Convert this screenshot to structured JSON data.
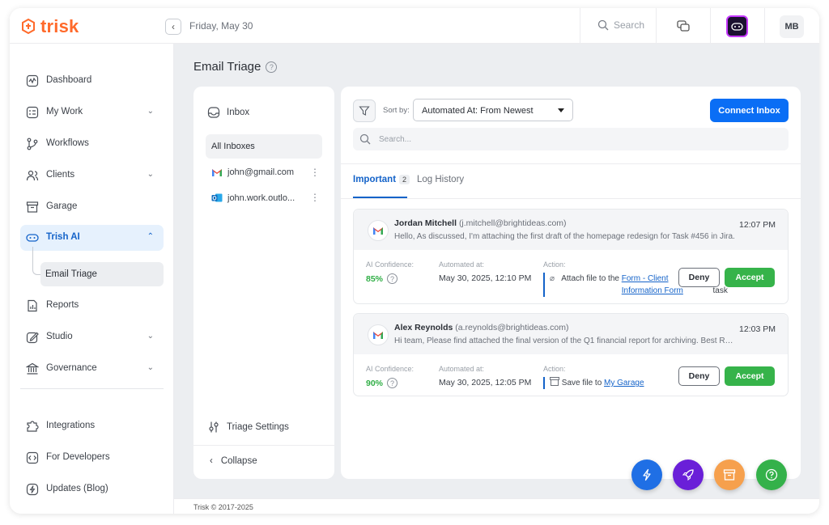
{
  "app": {
    "logo_text": "trisk",
    "brand_color": "#ff6a2b",
    "accent_color": "#0a6ef5"
  },
  "topbar": {
    "date": "Friday, May 30",
    "search_placeholder": "Search",
    "avatar_initials": "MB"
  },
  "sidebar": {
    "items": [
      {
        "label": "Dashboard",
        "icon": "dashboard-icon"
      },
      {
        "label": "My Work",
        "icon": "my-work-icon",
        "chevron": "down"
      },
      {
        "label": "Workflows",
        "icon": "workflow-icon"
      },
      {
        "label": "Clients",
        "icon": "clients-icon",
        "chevron": "down"
      },
      {
        "label": "Garage",
        "icon": "archive-icon"
      },
      {
        "label": "Trish AI",
        "icon": "bot-icon",
        "chevron": "up",
        "active": true
      },
      {
        "label": "Reports",
        "icon": "reports-icon"
      },
      {
        "label": "Studio",
        "icon": "edit-icon",
        "chevron": "down"
      },
      {
        "label": "Governance",
        "icon": "bank-icon",
        "chevron": "down"
      }
    ],
    "sub_item": "Email Triage",
    "bottom_items": [
      {
        "label": "Integrations",
        "icon": "puzzle-icon"
      },
      {
        "label": "For Developers",
        "icon": "code-icon"
      },
      {
        "label": "Updates (Blog)",
        "icon": "updates-icon"
      }
    ]
  },
  "page": {
    "title": "Email Triage"
  },
  "inbox_panel": {
    "heading": "Inbox",
    "all_inboxes": "All Inboxes",
    "accounts": [
      {
        "email": "john@gmail.com",
        "provider": "gmail-icon"
      },
      {
        "email": "john.work.outlo...",
        "provider": "outlook-icon"
      }
    ],
    "settings_label": "Triage Settings",
    "collapse_label": "Collapse"
  },
  "mail_panel": {
    "sort_label": "Sort by:",
    "sort_value": "Automated At: From Newest",
    "connect_label": "Connect Inbox",
    "search_placeholder": "Search...",
    "tabs": [
      {
        "label": "Important",
        "count": "2",
        "active": true
      },
      {
        "label": "Log History"
      }
    ],
    "labels": {
      "confidence": "AI Confidence:",
      "automated": "Automated at:",
      "action": "Action:",
      "deny": "Deny",
      "accept": "Accept"
    },
    "emails": [
      {
        "sender": "Jordan Mitchell",
        "address": "(j.mitchell@brightideas.com)",
        "preview": "Hello, As discussed, I'm attaching the first draft of the homepage redesign for Task #456 in Jira.",
        "time": "12:07 PM",
        "confidence": "85%",
        "automated_at": "May 30, 2025, 12:10 PM",
        "action_icon": "paperclip-icon",
        "action_prefix": "Attach file to the",
        "action_link": "Form - Client Information Form",
        "action_suffix": "task"
      },
      {
        "sender": "Alex Reynolds",
        "address": "(a.reynolds@brightideas.com)",
        "preview": "Hi team, Please find attached the final version of the Q1 financial report for archiving. Best Regards.",
        "time": "12:03 PM",
        "confidence": "90%",
        "automated_at": "May 30, 2025, 12:05 PM",
        "action_icon": "archive-icon",
        "action_prefix": "Save file to",
        "action_link": "My Garage",
        "action_suffix": ""
      }
    ]
  },
  "fabs": [
    {
      "icon": "lightning-icon",
      "color": "#1f6fe5"
    },
    {
      "icon": "rocket-icon",
      "color": "#6a1fd8"
    },
    {
      "icon": "archive-icon",
      "color": "#f6a04d"
    },
    {
      "icon": "help-icon",
      "color": "#34b14a"
    }
  ],
  "footer": {
    "text": "Trisk © 2017-2025"
  }
}
